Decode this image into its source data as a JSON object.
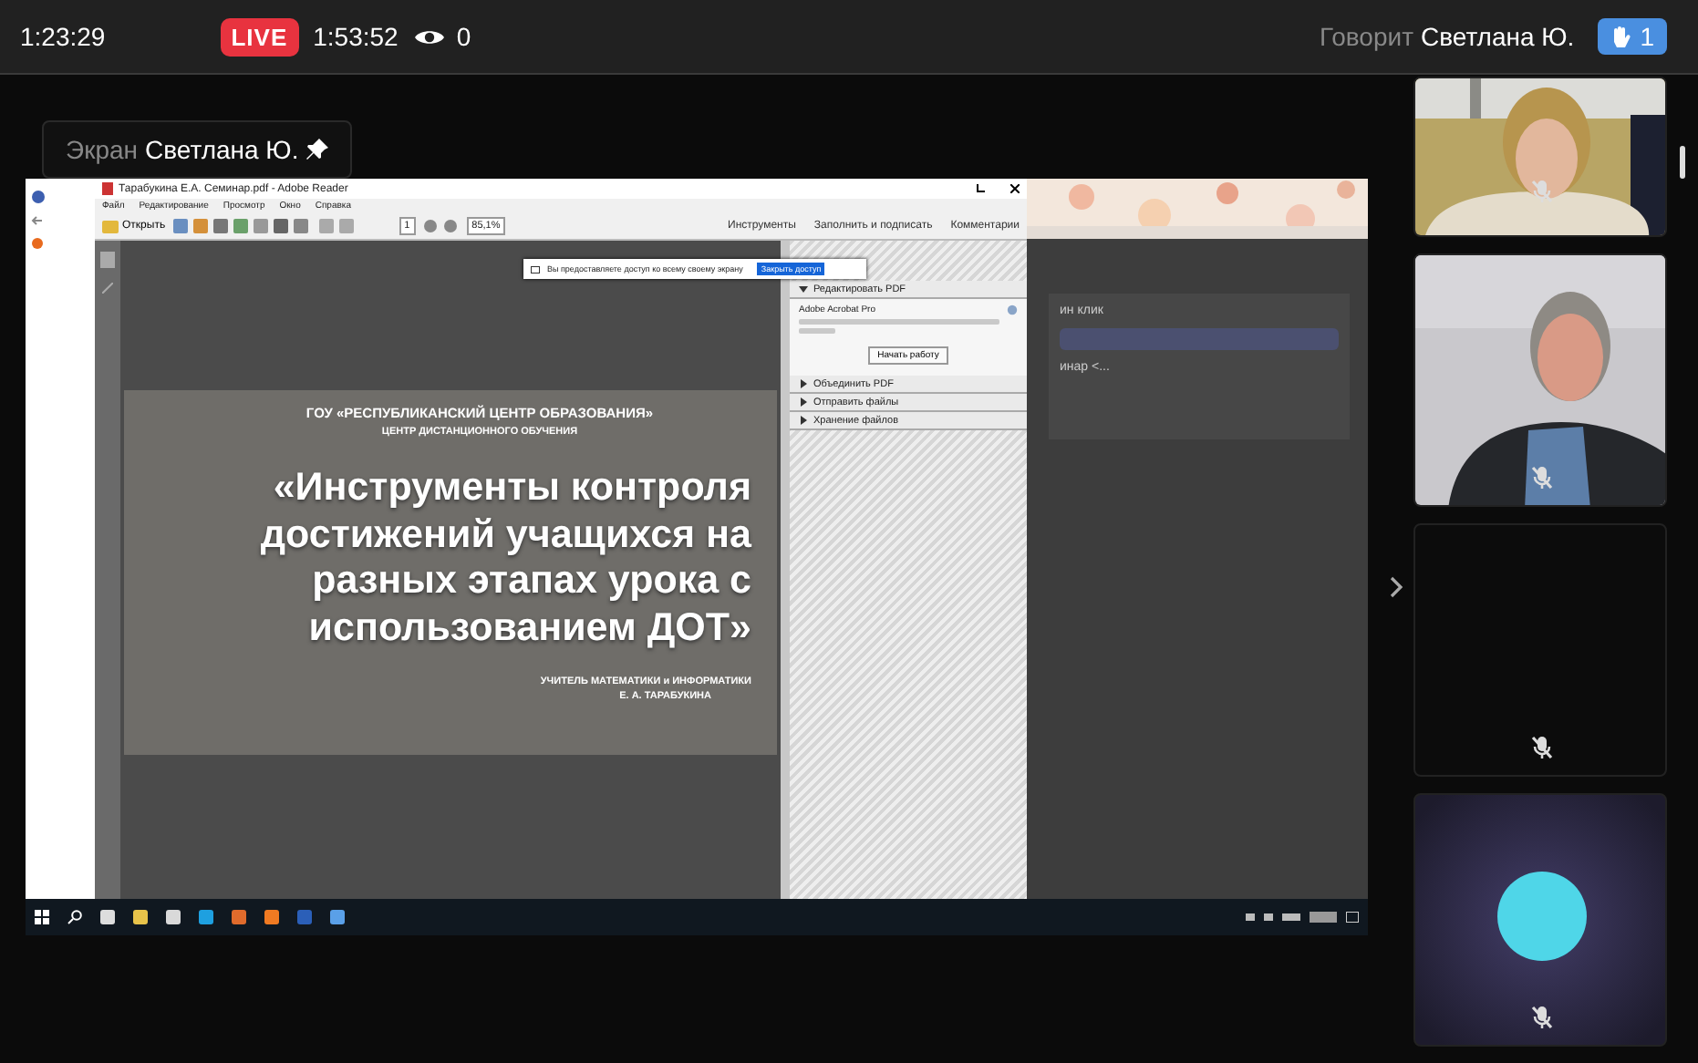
{
  "top_bar": {
    "elapsed": "1:23:29",
    "live_badge": "LIVE",
    "stream_time": "1:53:52",
    "viewers": "0",
    "speaking_label": "Говорит",
    "speaker": "Светлана Ю.",
    "raised_hands": "1"
  },
  "screen_share": {
    "label": "Экран",
    "presenter": "Светлана Ю.",
    "pinned": true,
    "reader": {
      "title": "Тарабукина Е.А. Семинар.pdf - Adobe Reader",
      "menu": [
        "Файл",
        "Редактирование",
        "Просмотр",
        "Окно",
        "Справка"
      ],
      "open_button": "Открыть",
      "page": "1",
      "zoom": "85,1%",
      "tabs": [
        "Инструменты",
        "Заполнить и подписать",
        "Комментарии"
      ],
      "share_notice": {
        "text": "Вы предоставляете доступ ко всему своему экрану",
        "button": "Закрыть доступ"
      },
      "panel_sections": [
        {
          "title": "Редактировать PDF",
          "expanded": true,
          "product": "Adobe Acrobat Pro",
          "button": "Начать работу"
        },
        {
          "title": "Объединить PDF",
          "expanded": false
        },
        {
          "title": "Отправить файлы",
          "expanded": false
        },
        {
          "title": "Хранение файлов",
          "expanded": false
        }
      ],
      "slide": {
        "organization": "ГОУ «РЕСПУБЛИКАНСКИЙ ЦЕНТР ОБРАЗОВАНИЯ»",
        "department": "ЦЕНТР ДИСТАНЦИОННОГО ОБУЧЕНИЯ",
        "title_lines": [
          "«Инструменты контроля",
          "достижений учащихся на",
          "разных этапах урока с",
          "использованием ДОТ»"
        ],
        "author_role": "УЧИТЕЛЬ МАТЕМАТИКИ и ИНФОРМАТИКИ",
        "author": "Е. А. ТАРАБУКИНА"
      }
    },
    "browser_fragments": [
      "ин клик",
      "инар <..."
    ]
  },
  "participants": [
    {
      "kind": "video",
      "muted": true
    },
    {
      "kind": "video",
      "muted": true
    },
    {
      "kind": "empty",
      "muted": true
    },
    {
      "kind": "avatar",
      "color": "#4fd6e8",
      "muted": true
    }
  ]
}
